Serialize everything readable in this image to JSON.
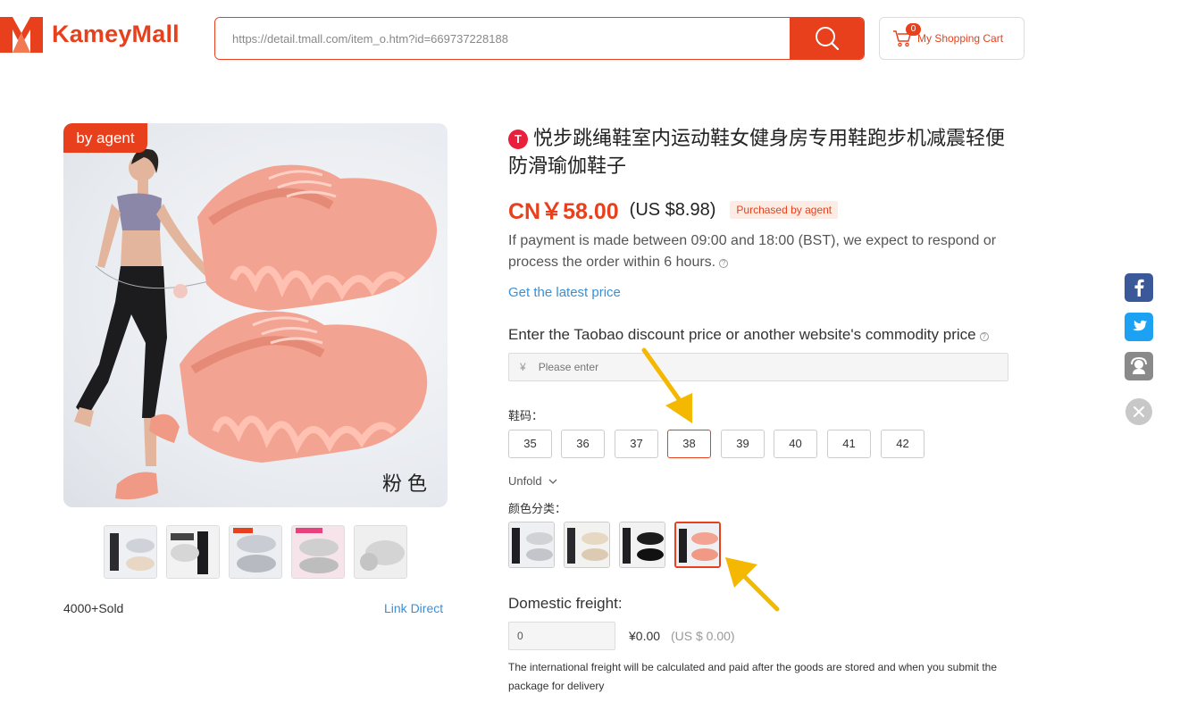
{
  "header": {
    "brand": "KameyMall",
    "search_value": "https://detail.tmall.com/item_o.htm?id=669737228188",
    "cart_count": "0",
    "cart_label": "My Shopping Cart"
  },
  "gallery": {
    "agent_tag": "by agent",
    "color_caption": "粉色",
    "sold": "4000+Sold",
    "link_direct": "Link Direct",
    "thumbnails": 5
  },
  "product": {
    "platform_icon": "T",
    "title": "悦步跳绳鞋室内运动鞋女健身房专用鞋跑步机减震轻便防滑瑜伽鞋子",
    "price_cn": "CN￥58.00",
    "price_us": "(US $8.98)",
    "agent_badge": "Purchased by agent",
    "notice": "If payment is made between 09:00 and 18:00 (BST), we expect to respond or process the order within 6 hours.",
    "latest_price": "Get the latest price"
  },
  "discount": {
    "label": "Enter the Taobao discount price or another website's commodity price",
    "currency": "¥",
    "placeholder": "Please enter"
  },
  "size": {
    "label": "鞋码：",
    "options": [
      "35",
      "36",
      "37",
      "38",
      "39",
      "40",
      "41",
      "42"
    ],
    "selected": "38",
    "unfold": "Unfold"
  },
  "color": {
    "label": "颜色分类：",
    "options": [
      "gray",
      "beige",
      "black",
      "pink"
    ],
    "selected": "pink"
  },
  "freight": {
    "label": "Domestic freight:",
    "value": "0",
    "cn": "¥0.00",
    "us": "(US $ 0.00)",
    "note": "The international freight will be calculated and paid after the goods are stored and when you submit the package for delivery"
  },
  "social": [
    "facebook-icon",
    "twitter-icon",
    "customer-service-icon",
    "close-icon"
  ],
  "colors": {
    "accent": "#e8401c",
    "link": "#3a8fd6",
    "arrow": "#f5b800"
  }
}
